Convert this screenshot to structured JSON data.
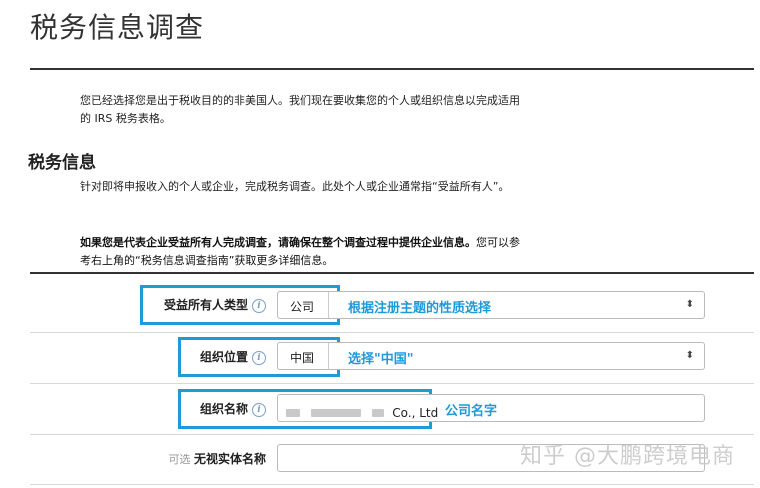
{
  "page": {
    "title": "税务信息调查"
  },
  "intro": "您已经选择您是出于税收目的的非美国人。我们现在要收集您的个人或组织信息以完成适用的 IRS 税务表格。",
  "tax_section": {
    "heading": "税务信息",
    "desc": "针对即将申报收入的个人或企业，完成税务调查。此处个人或企业通常指“受益所有人”。",
    "note_bold": "如果您是代表企业受益所有人完成调查，请确保在整个调查过程中提供企业信息。",
    "note_normal": "您可以参考右上角的“税务信息调查指南”获取更多详细信息。"
  },
  "form": {
    "owner_type": {
      "label": "受益所有人类型",
      "value": "公司",
      "annotation": "根据注册主题的性质选择"
    },
    "org_location": {
      "label": "组织位置",
      "value": "中国",
      "annotation": "选择\"中国\""
    },
    "org_name": {
      "label": "组织名称",
      "value_suffix": "Co., Ltd",
      "annotation": "公司名字"
    },
    "disregarded": {
      "optional": "可选",
      "label": "无视实体名称",
      "value": ""
    }
  },
  "icons": {
    "info": "info-icon",
    "select_arrow": "updown-chevron-icon"
  },
  "watermark": "知乎 @大鹏跨境电商",
  "colors": {
    "highlight": "#1e9ad6",
    "rule": "#333333"
  }
}
